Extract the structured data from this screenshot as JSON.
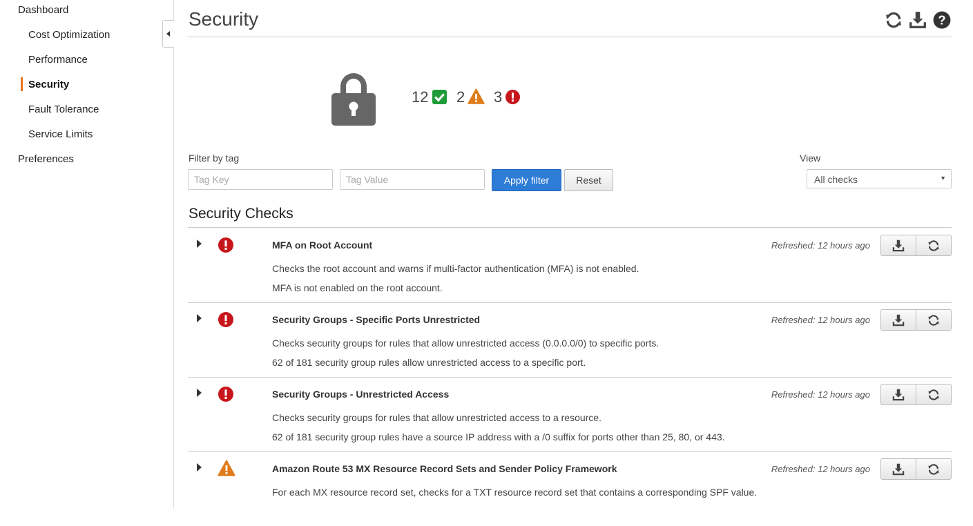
{
  "sidebar": {
    "dashboard": "Dashboard",
    "items": [
      {
        "label": "Cost Optimization"
      },
      {
        "label": "Performance"
      },
      {
        "label": "Security"
      },
      {
        "label": "Fault Tolerance"
      },
      {
        "label": "Service Limits"
      }
    ],
    "preferences": "Preferences"
  },
  "header": {
    "title": "Security",
    "icons": [
      "refresh-icon",
      "download-icon",
      "help-icon"
    ]
  },
  "summary": {
    "ok_count": "12",
    "warning_count": "2",
    "error_count": "3",
    "colors": {
      "ok": "#1e9c3a",
      "warning": "#e07b1a",
      "error": "#c7161b"
    }
  },
  "filter": {
    "label": "Filter by tag",
    "tag_key_placeholder": "Tag Key",
    "tag_key_value": "",
    "tag_value_placeholder": "Tag Value",
    "tag_value_value": "",
    "apply_label": "Apply filter",
    "reset_label": "Reset"
  },
  "view": {
    "label": "View",
    "selected": "All checks"
  },
  "checks_section": {
    "title": "Security Checks",
    "checks": [
      {
        "status": "error",
        "name": "MFA on Root Account",
        "description": "Checks the root account and warns if multi-factor authentication (MFA) is not enabled.",
        "result": "MFA is not enabled on the root account.",
        "refreshed": "Refreshed: 12 hours ago"
      },
      {
        "status": "error",
        "name": "Security Groups - Specific Ports Unrestricted",
        "description": "Checks security groups for rules that allow unrestricted access (0.0.0.0/0) to specific ports.",
        "result": "62 of 181 security group rules allow unrestricted access to a specific port.",
        "refreshed": "Refreshed: 12 hours ago"
      },
      {
        "status": "error",
        "name": "Security Groups - Unrestricted Access",
        "description": "Checks security groups for rules that allow unrestricted access to a resource.",
        "result": "62 of 181 security group rules have a source IP address with a /0 suffix for ports other than 25, 80, or 443.",
        "refreshed": "Refreshed: 12 hours ago"
      },
      {
        "status": "warning",
        "name": "Amazon Route 53 MX Resource Record Sets and Sender Policy Framework",
        "description": "For each MX resource record set, checks for a TXT resource record set that contains a corresponding SPF value.",
        "result": "",
        "refreshed": "Refreshed: 12 hours ago"
      }
    ]
  }
}
